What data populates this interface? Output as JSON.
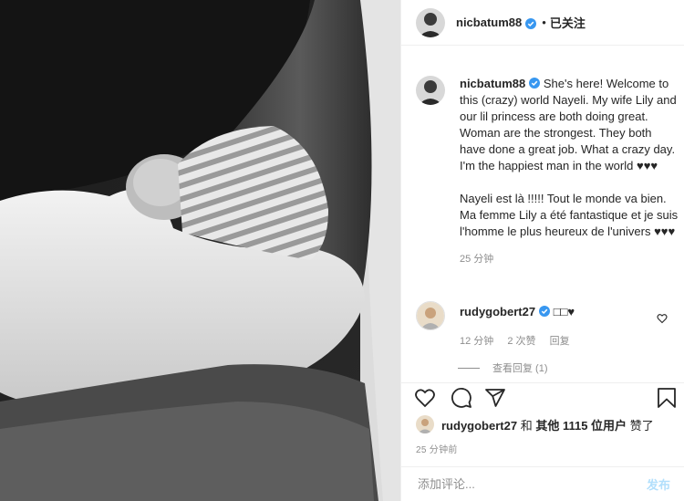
{
  "post": {
    "author": "nicbatum88",
    "follow_separator": "•",
    "follow_status": "已关注"
  },
  "caption": {
    "username": "nicbatum88",
    "text_en": "She's here! Welcome to this (crazy) world Nayeli. My wife Lily and our lil princess are both doing great. Woman are the strongest. They both have done a great job. What a crazy day. I'm the happiest man in the world ♥♥♥",
    "text_fr": "Nayeli est là !!!!! Tout le monde va bien. Ma femme Lily a été fantastique et je suis l'homme le plus heureux de l'univers ♥♥♥",
    "time": "25 分钟"
  },
  "comment": {
    "username": "rudygobert27",
    "text": "□□♥",
    "time": "12 分钟",
    "likes": "2 次赞",
    "reply": "回复",
    "view_replies": "查看回复 (1)"
  },
  "likes": {
    "user": "rudygobert27",
    "and": "和",
    "others": "其他 1115 位用户",
    "liked": "赞了"
  },
  "timestamp": "25 分钟前",
  "add_comment": {
    "placeholder": "添加评论...",
    "post_label": "发布"
  },
  "colors": {
    "verified": "#3897f0",
    "secondary_text": "#8e8e8e",
    "post_disabled": "#b2dffc",
    "border": "#efefef"
  },
  "icons": [
    "verified-badge-icon",
    "heart-icon",
    "comment-icon",
    "share-icon",
    "bookmark-icon",
    "small-heart-icon"
  ]
}
